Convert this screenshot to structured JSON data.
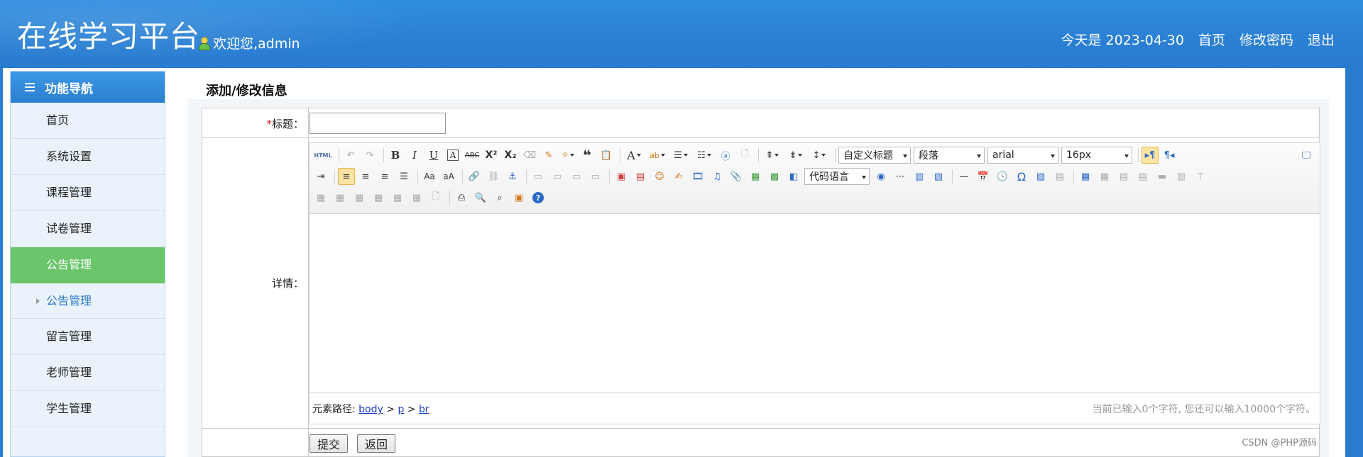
{
  "header": {
    "site_title": "在线学习平台",
    "welcome": "欢迎您,admin",
    "date_text": "今天是 2023-04-30",
    "links": [
      "首页",
      "修改密码",
      "退出"
    ]
  },
  "sidebar": {
    "heading": "功能导航",
    "items": [
      "首页",
      "系统设置",
      "课程管理",
      "试卷管理",
      "公告管理"
    ],
    "active_item": "公告管理",
    "sub_item": "公告管理",
    "items_after": [
      "留言管理",
      "老师管理",
      "学生管理"
    ]
  },
  "page": {
    "title": "添加/修改信息"
  },
  "form": {
    "required_mark": "*",
    "title_label": "标题：",
    "title_value": "",
    "detail_label": "详情：",
    "submit_label": "提交",
    "back_label": "返回"
  },
  "editor": {
    "toolbar": {
      "html_label": "HTML",
      "custom_heading": "自定义标题",
      "paragraph": "段落",
      "font_family": "arial",
      "font_size": "16px",
      "code_language": "代码语言"
    },
    "path_label": "元素路径:",
    "path": [
      "body",
      "p",
      "br"
    ],
    "word_count": "当前已输入0个字符, 您还可以输入10000个字符。"
  },
  "watermark": "CSDN @PHP源码",
  "colors": {
    "header_blue": "#2b82d6",
    "active_green": "#6bc56b",
    "required_red": "#e02020"
  }
}
